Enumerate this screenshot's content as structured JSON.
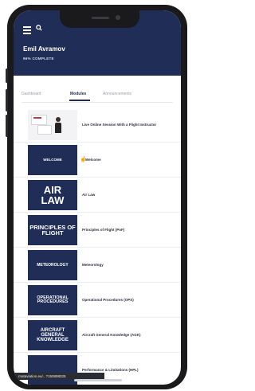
{
  "header": {
    "user_name": "Emil Avramov",
    "progress_text": "96% COMPLETE"
  },
  "tabs": [
    {
      "label": "Dashboard"
    },
    {
      "label": "Modules"
    },
    {
      "label": "Announcements"
    }
  ],
  "modules": [
    {
      "thumb": "",
      "label": "Live Online Session With a Flight Instructor"
    },
    {
      "thumb": "WELCOME",
      "label": "Welcome"
    },
    {
      "thumb": "AIR LAW",
      "label": "Air Law"
    },
    {
      "thumb": "PRINCIPLES OF FLIGHT",
      "label": "Principles of Flight (PoF)"
    },
    {
      "thumb": "METEOROLOGY",
      "label": "Meteorology"
    },
    {
      "thumb": "OPERATIONAL PROCEDURES",
      "label": "Operational Procedures (OPS)"
    },
    {
      "thumb": "AIRCRAFT GENERAL KNOWLEDGE",
      "label": "Aircraft General Knowledge (AGK)"
    },
    {
      "thumb": "",
      "label": "Performance & Limitations (HPL)"
    }
  ],
  "status_bar": {
    "url": "rnataviation.eu/...?150898025"
  },
  "colors": {
    "primary": "#1f2d57",
    "text": "#2b2f3a",
    "muted": "#9aa0ab"
  }
}
